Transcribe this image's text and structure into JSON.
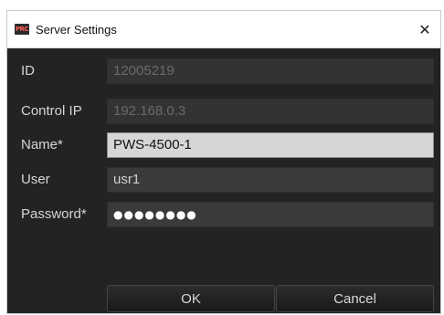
{
  "window": {
    "title": "Server Settings",
    "app_icon_text": "PRC",
    "close_glyph": "✕"
  },
  "form": {
    "fields": [
      {
        "label": "ID",
        "value": "12005219",
        "state": "disabled"
      },
      {
        "label": "Control IP",
        "value": "192.168.0.3",
        "state": "disabled"
      },
      {
        "label": "Name*",
        "value": "PWS-4500-1",
        "state": "active"
      },
      {
        "label": "User",
        "value": "usr1",
        "state": "normal"
      },
      {
        "label": "Password*",
        "value": "●●●●●●●●",
        "state": "normal"
      }
    ]
  },
  "buttons": {
    "ok_label": "OK",
    "cancel_label": "Cancel"
  },
  "colors": {
    "panel_bg": "#232323",
    "field_bg": "#3a3a3a",
    "active_field_bg": "#d6d6d6",
    "label_text": "#d6d6d6"
  }
}
